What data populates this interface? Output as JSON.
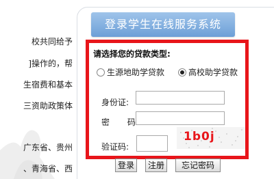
{
  "background_article": {
    "lines": [
      "校共同给予",
      "]操作的，帮",
      "生宿费和基本",
      "三资助政策体",
      "广东省、贵州",
      "、青海省、西"
    ]
  },
  "login_panel": {
    "title": "登录学生在线服务系统",
    "loan_type_prompt": "请选择您的贷款类型:",
    "loan_options": [
      {
        "label": "生源地助学贷款",
        "selected": false
      },
      {
        "label": "高校助学贷款",
        "selected": true
      }
    ],
    "fields": {
      "id_label": "身份证:",
      "id_value": "",
      "password_label": "密 码:",
      "password_value": "",
      "captcha_label": "验证码:",
      "captcha_value": ""
    },
    "captcha_image_text": "1b0j",
    "buttons": {
      "login": "登录",
      "register": "注册",
      "forgot_password": "忘记密码"
    }
  },
  "colors": {
    "highlight_frame": "#e8151a",
    "title_bar": "#7fadde",
    "captcha_text": "#e8151a"
  }
}
